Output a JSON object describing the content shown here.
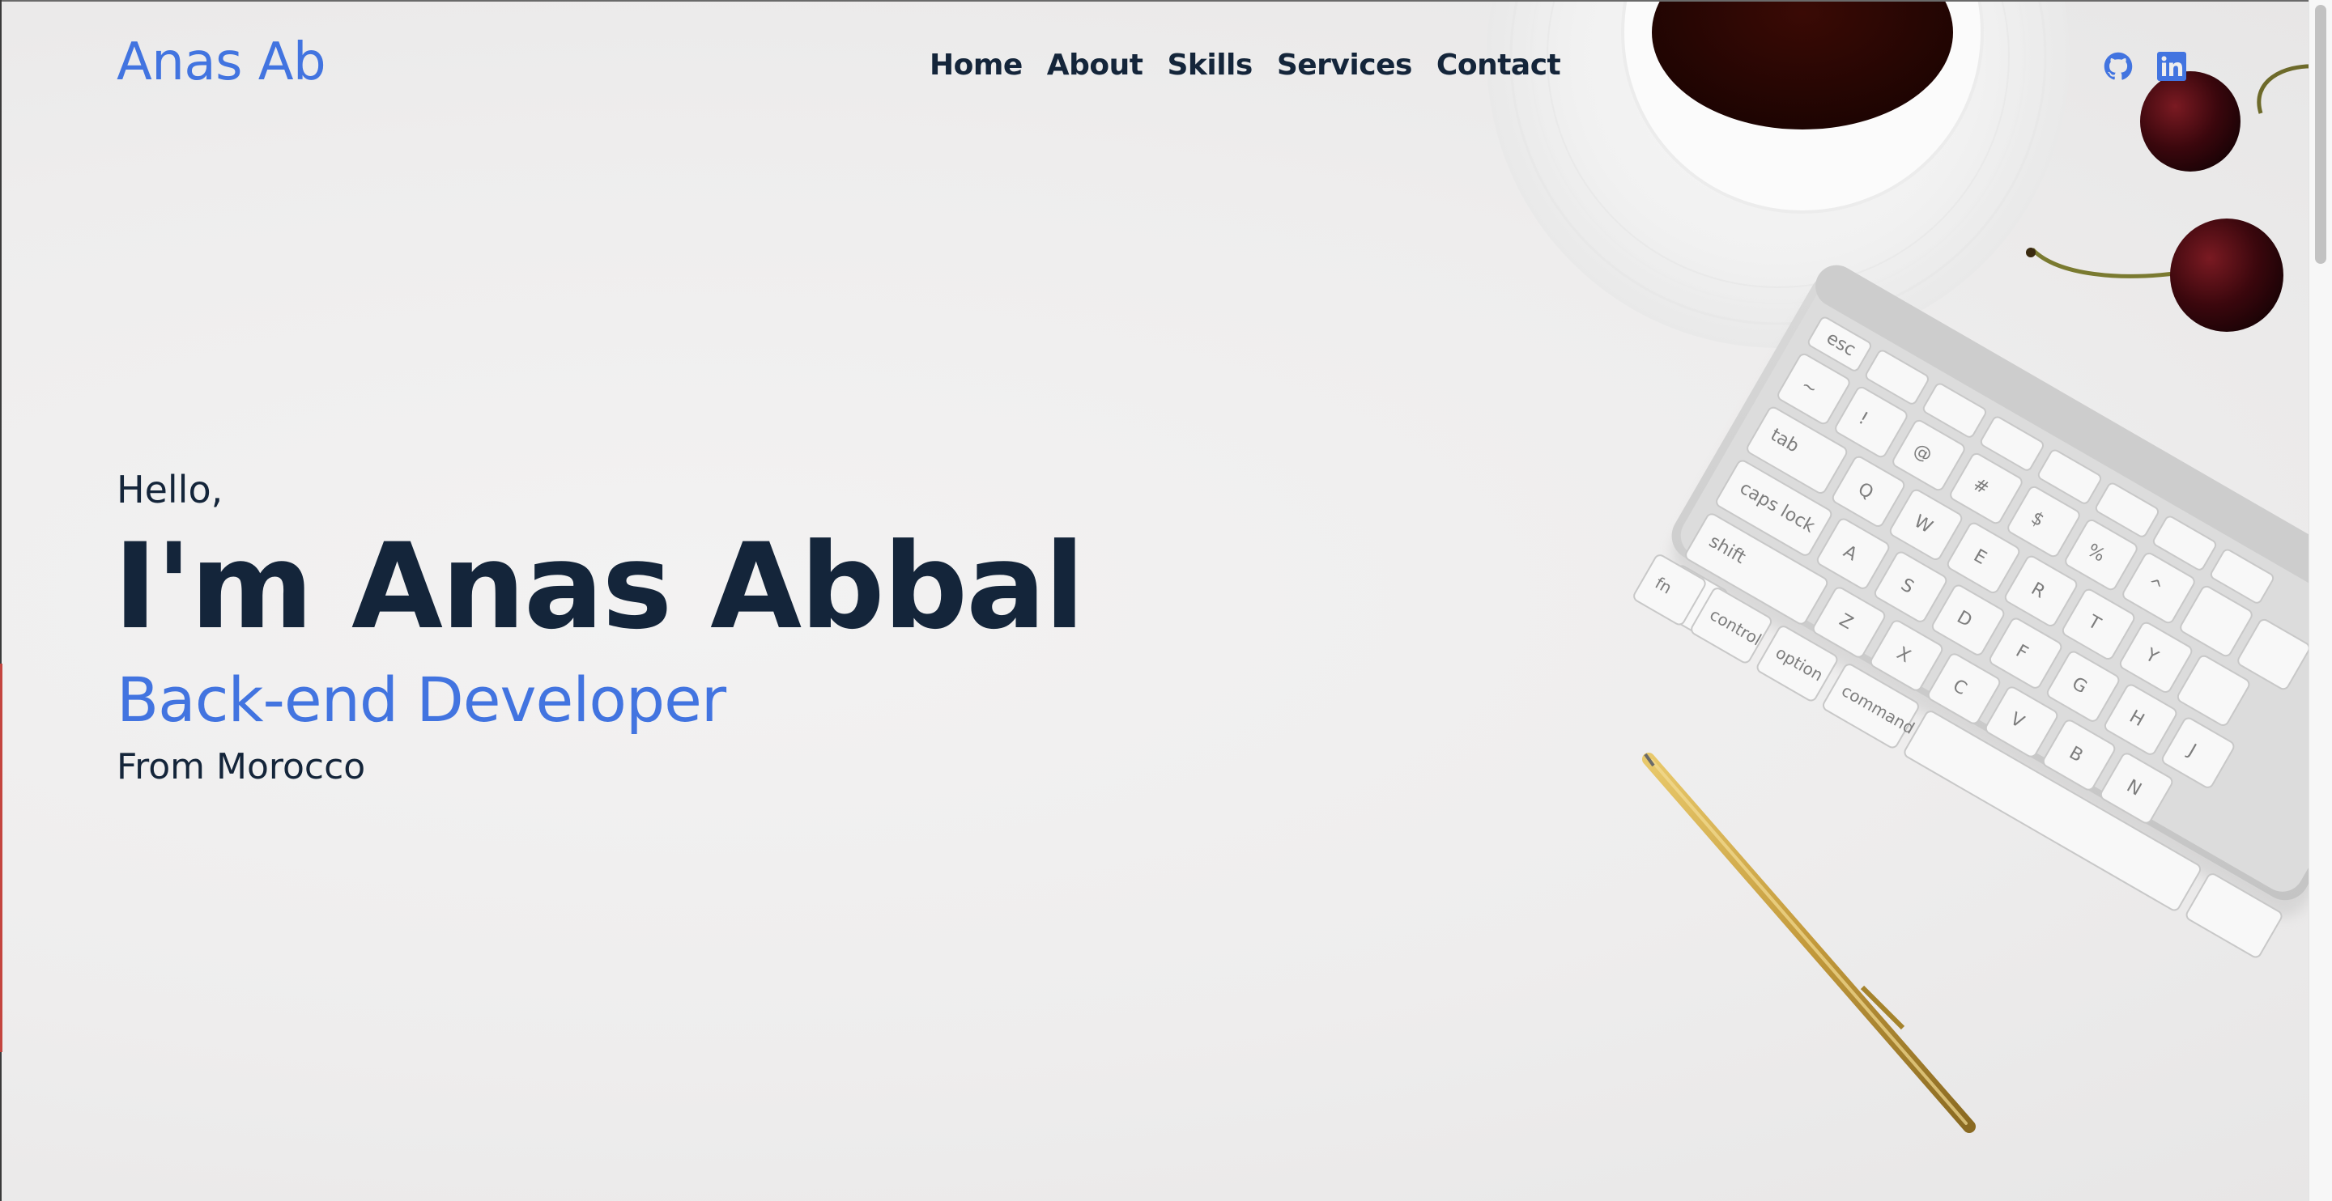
{
  "header": {
    "logo": "Anas Ab",
    "nav": [
      "Home",
      "About",
      "Skills",
      "Services",
      "Contact"
    ],
    "social": [
      {
        "icon": "github-icon",
        "label": "GitHub"
      },
      {
        "icon": "linkedin-icon",
        "label": "LinkedIn"
      }
    ]
  },
  "hero": {
    "greeting": "Hello,",
    "name": "I'm Anas Abbal",
    "role": "Back-end Developer",
    "location": "From Morocco"
  },
  "colors": {
    "accent": "#4274e0",
    "text": "#14253a",
    "background": "#efeeee"
  }
}
